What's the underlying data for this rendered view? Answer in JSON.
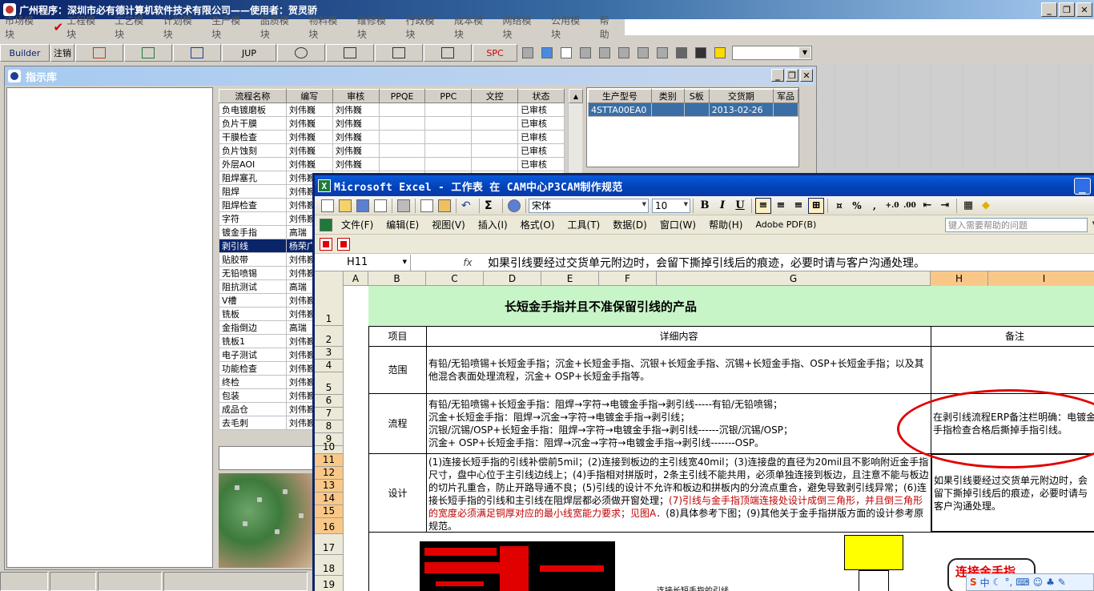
{
  "app": {
    "title": "广州程序：深圳市必有德计算机软件技术有限公司——使用者：贺灵骄",
    "window_buttons": [
      "_",
      "❐",
      "✕"
    ]
  },
  "module_menu": {
    "items": [
      "市场模块",
      "工程模块",
      "工艺模块",
      "计划模块",
      "生产模块",
      "品质模块",
      "物料模块",
      "维修模块",
      "行政模块",
      "成本模块",
      "网络模块",
      "公用模块",
      "帮助"
    ],
    "checked": "工程模块"
  },
  "main_toolbar": {
    "builder": "Builder",
    "logout": "注销",
    "jup": "JUP",
    "spc": "SPC"
  },
  "lib_window": {
    "title": "指示库",
    "flow_columns": [
      "流程名称",
      "编写",
      "审核",
      "PPQE",
      "PPC",
      "文控",
      "状态"
    ],
    "flow_rows": [
      {
        "name": "负电镀磨板",
        "writer": "刘伟巍",
        "reviewer": "刘伟巍",
        "status": "已审核"
      },
      {
        "name": "负片干膜",
        "writer": "刘伟巍",
        "reviewer": "刘伟巍",
        "status": "已审核"
      },
      {
        "name": "干膜检查",
        "writer": "刘伟巍",
        "reviewer": "刘伟巍",
        "status": "已审核"
      },
      {
        "name": "负片蚀刻",
        "writer": "刘伟巍",
        "reviewer": "刘伟巍",
        "status": "已审核"
      },
      {
        "name": "外层AOI",
        "writer": "刘伟巍",
        "reviewer": "刘伟巍",
        "status": "已审核"
      },
      {
        "name": "阻焊塞孔",
        "writer": "刘伟巍",
        "reviewer": "",
        "status": ""
      },
      {
        "name": "阻焊",
        "writer": "刘伟巍",
        "reviewer": "",
        "status": ""
      },
      {
        "name": "阻焊检查",
        "writer": "刘伟巍",
        "reviewer": "",
        "status": ""
      },
      {
        "name": "字符",
        "writer": "刘伟巍",
        "reviewer": "",
        "status": ""
      },
      {
        "name": "镀金手指",
        "writer": "高瑞",
        "reviewer": "",
        "status": ""
      },
      {
        "name": "剥引线",
        "writer": "杨荣广",
        "reviewer": "",
        "status": ""
      },
      {
        "name": "贴胶带",
        "writer": "刘伟巍",
        "reviewer": "",
        "status": ""
      },
      {
        "name": "无铅喷锡",
        "writer": "刘伟巍",
        "reviewer": "",
        "status": ""
      },
      {
        "name": "阻抗测试",
        "writer": "高瑞",
        "reviewer": "",
        "status": ""
      },
      {
        "name": "V槽",
        "writer": "刘伟巍",
        "reviewer": "",
        "status": ""
      },
      {
        "name": "铣板",
        "writer": "刘伟巍",
        "reviewer": "",
        "status": ""
      },
      {
        "name": "金指倒边",
        "writer": "高瑞",
        "reviewer": "",
        "status": ""
      },
      {
        "name": "铣板1",
        "writer": "刘伟巍",
        "reviewer": "",
        "status": ""
      },
      {
        "name": "电子测试",
        "writer": "刘伟巍",
        "reviewer": "",
        "status": ""
      },
      {
        "name": "功能检查",
        "writer": "刘伟巍",
        "reviewer": "",
        "status": ""
      },
      {
        "name": "终检",
        "writer": "刘伟巍",
        "reviewer": "",
        "status": ""
      },
      {
        "name": "包装",
        "writer": "刘伟巍",
        "reviewer": "",
        "status": ""
      },
      {
        "name": "成品仓",
        "writer": "刘伟巍",
        "reviewer": "",
        "status": ""
      },
      {
        "name": "去毛刺",
        "writer": "刘伟巍",
        "reviewer": "",
        "status": ""
      }
    ],
    "product_columns": [
      "生产型号",
      "类别",
      "S板",
      "交货期",
      "军品"
    ],
    "product_rows": [
      {
        "model": "4STTA00EA0",
        "category": "",
        "s": "",
        "delivery": "2013-02-26",
        "military": ""
      }
    ]
  },
  "excel": {
    "title": "Microsoft Excel - 工作表 在 CAM中心P3CAM制作规范",
    "font_name": "宋体",
    "font_size": "10",
    "menu": [
      "文件(F)",
      "编辑(E)",
      "视图(V)",
      "插入(I)",
      "格式(O)",
      "工具(T)",
      "数据(D)",
      "窗口(W)",
      "帮助(H)",
      "Adobe PDF(B)"
    ],
    "help_placeholder": "键入需要帮助的问题",
    "name_box": "H11",
    "fx": "fx",
    "formula": "如果引线要经过交货单元附边时，会留下撕掉引线后的痕迹，必要时请与客户沟通处理。",
    "columns": [
      "A",
      "B",
      "C",
      "D",
      "E",
      "F",
      "G",
      "H",
      "I"
    ],
    "rows": [
      "1",
      "2",
      "3",
      "4",
      "5",
      "6",
      "7",
      "8",
      "9",
      "10",
      "11",
      "12",
      "13",
      "14",
      "15",
      "16",
      "17",
      "18",
      "19"
    ],
    "sheet": {
      "title": "长短金手指并且不准保留引线的产品",
      "hdr_item": "项目",
      "hdr_detail": "详细内容",
      "hdr_note": "备注",
      "scope_label": "范围",
      "scope_text": "有铅/无铅喷锡+长短金手指；沉金+长短金手指、沉银+长短金手指、沉锡+长短金手指、OSP+长短金手指；以及其他混合表面处理流程，沉金+ OSP+长短金手指等。",
      "flow_label": "流程",
      "flow_lines": [
        "有铅/无铅喷锡+长短金手指：阻焊→字符→电镀金手指→剥引线-----有铅/无铅喷锡；",
        "沉金+长短金手指：阻焊→沉金→字符→电镀金手指→剥引线；",
        "沉银/沉锡/OSP+长短金手指：阻焊→字符→电镀金手指→剥引线------沉银/沉锡/OSP；",
        "沉金+ OSP+长短金手指：阻焊→沉金→字符→电镀金手指→剥引线-------OSP。"
      ],
      "flow_note": "在剥引线流程ERP备注栏明确：电镀金手指检查合格后撕掉手指引线。",
      "design_label": "设计",
      "design_text_1": "(1)连接长短手指的引线补偿前5mil；(2)连接到板边的主引线宽40mil；(3)连接盘的直径为20mil且不影响附近金手指尺寸，盘中心位于主引线边线上；(4)手指相对拼版时，2条主引线不能共用，必须单独连接到板边，且注意不能与板边的切片孔重合，防止开路导通不良；(5)引线的设计不允许和板边和拼板内的分流点重合，避免导致剥引线异常；(6)连接长短手指的引线和主引线在阻焊层都必须做开窗处理；",
      "design_text_red": "(7)引线与金手指顶端连接处设计成倒三角形，并且倒三角形的宽度必须满足铜厚对应的最小线宽能力要求；见图A．",
      "design_text_2": "(8)具体参考下图；(9)其他关于金手指拼版方面的设计参考原规范。",
      "design_note": "如果引线要经过交货单元附边时，会留下撕掉引线后的痕迹，必要时请与客户沟通处理。",
      "diagram_note": "连接长短手指的引线",
      "callout_text": "连接金手指"
    }
  },
  "ime": {
    "label": "中"
  }
}
